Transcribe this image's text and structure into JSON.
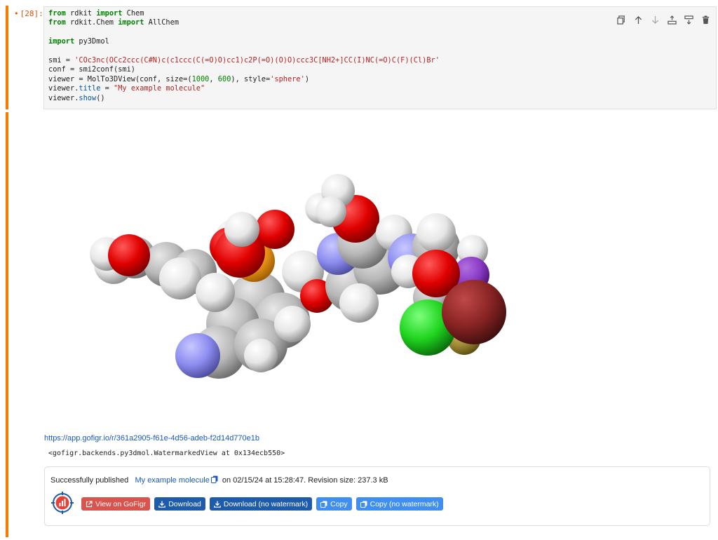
{
  "cell": {
    "prompt": "[28]:",
    "code_lines": [
      "from rdkit import Chem",
      "from rdkit.Chem import AllChem",
      "",
      "import py3Dmol",
      "",
      "smi = 'COc3nc(OCc2ccc(C#N)c(c1ccc(C(=O)O)cc1)c2P(=O)(O)O)ccc3C[NH2+]CC(I)NC(=O)C(F)(Cl)Br'",
      "conf = smi2conf(smi)",
      "viewer = MolTo3DView(conf, size=(1000, 600), style='sphere')",
      "viewer.title = \"My example molecule\"",
      "viewer.show()"
    ],
    "toolbar_icons": [
      "duplicate-icon",
      "move-up-icon",
      "move-down-icon",
      "insert-above-icon",
      "insert-below-icon",
      "delete-icon"
    ]
  },
  "output": {
    "link": "https://app.gofigr.io/r/361a2905-f61e-4d56-adeb-f2d14d770e1b",
    "repr": "<gofigr.backends.py3dmol.WatermarkedView at 0x134ecb550>",
    "status": {
      "prefix": "Successfully published",
      "title": "My example molecule",
      "suffix": "on 02/15/24 at 15:28:47. Revision size: 237.3 kB"
    },
    "buttons": {
      "view": "View on GoFigr",
      "download": "Download",
      "download_nowm": "Download (no watermark)",
      "copy": "Copy",
      "copy_nowm": "Copy (no watermark)"
    }
  },
  "colors": {
    "cell_bar": "#f57c00",
    "btn_red": "#d9534f",
    "btn_navy": "#1f5bab",
    "btn_blue": "#3f8ef0",
    "link": "#1a56c4"
  }
}
